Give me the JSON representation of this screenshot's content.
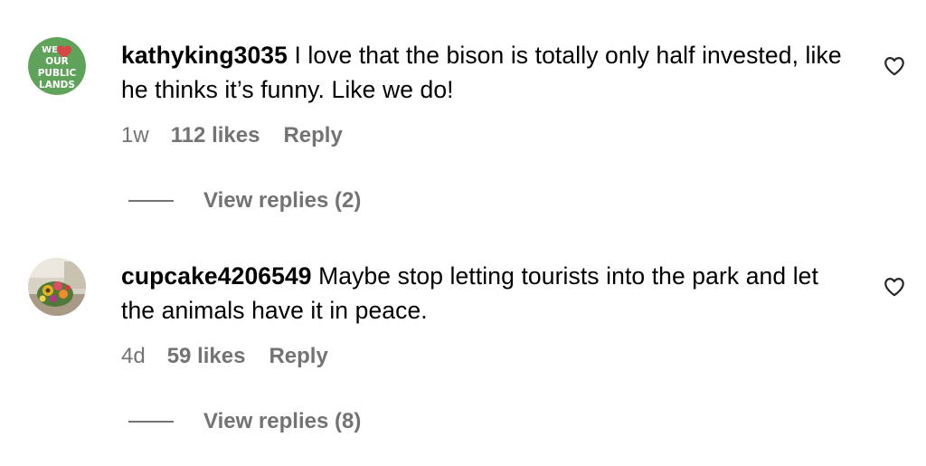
{
  "comments": [
    {
      "avatar_text": [
        "WE",
        "OUR",
        "PUBLIC",
        "LANDS"
      ],
      "avatar_icon": "logo-we-love-our-public-lands",
      "username": "kathyking3035",
      "text": "I love that the bison is totally only half invested, like he thinks it’s funny. Like we do!",
      "age": "1w",
      "likes": "112 likes",
      "reply_label": "Reply",
      "view_replies": "View replies (2)",
      "like_icon": "heart-outline-icon"
    },
    {
      "avatar_icon": "photo-flower-bouquet",
      "username": "cupcake4206549",
      "text": "Maybe stop letting tourists into the park and let the animals have it in peace.",
      "age": "4d",
      "likes": "59 likes",
      "reply_label": "Reply",
      "view_replies": "View replies (8)",
      "like_icon": "heart-outline-icon"
    }
  ],
  "colors": {
    "secondary_text": "#737373",
    "avatar1_bg": "#5fa35a",
    "avatar1_heart": "#d94545"
  }
}
